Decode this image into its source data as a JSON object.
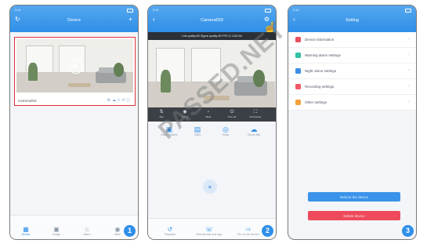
{
  "phone1": {
    "badge": "1",
    "header_title": "Device",
    "add_icon": "plus-icon",
    "camera_name": "Camera003",
    "card_icons": [
      "settings-icon",
      "cloud-icon",
      "share-icon",
      "playback-icon",
      "delete-icon"
    ],
    "tabs": [
      {
        "label": "Device",
        "icon": "device-icon",
        "active": true
      },
      {
        "label": "Image",
        "icon": "image-icon",
        "active": false
      },
      {
        "label": "Alarm",
        "icon": "bell-icon",
        "active": false
      },
      {
        "label": "Mine",
        "icon": "person-icon",
        "active": false
      }
    ]
  },
  "phone2": {
    "badge": "2",
    "header_title": "Camera003",
    "info_bar": "Link quality:60  Signal quality:56  FPS:11  CAN  Kb",
    "controls": [
      {
        "label": "Flip",
        "icon": "flip-icon"
      },
      {
        "label": "Sound",
        "icon": "sound-icon"
      },
      {
        "label": "Mute",
        "icon": "mute-icon"
      },
      {
        "label": "Turn off",
        "icon": "power-icon"
      },
      {
        "label": "Full screen",
        "icon": "fullscreen-icon"
      }
    ],
    "actions": [
      {
        "label": "Video Lantern",
        "icon": "video-icon"
      },
      {
        "label": "Video",
        "icon": "record-icon"
      },
      {
        "label": "Snap",
        "icon": "camera-icon"
      },
      {
        "label": "Cloud disk",
        "icon": "cloud-icon"
      }
    ],
    "bottom_actions": [
      {
        "label": "Playback",
        "icon": "playback-icon"
      },
      {
        "label": "Remote talk and sign",
        "icon": "talk-icon"
      },
      {
        "label": "Pin on the Screen",
        "icon": "pin-icon"
      }
    ]
  },
  "phone3": {
    "badge": "3",
    "header_title": "Setting",
    "menu": [
      {
        "label": "Device information",
        "color": "#e8505f"
      },
      {
        "label": "Warning alarm settings",
        "color": "#33c1a8"
      },
      {
        "label": "Night vision settings",
        "color": "#3f8fe6"
      },
      {
        "label": "Recording settings",
        "color": "#ee5a66"
      },
      {
        "label": "Other settings",
        "color": "#f3a23c"
      }
    ],
    "reboot_label": "Reboot the device",
    "delete_label": "Delete device"
  },
  "watermark": "PASSED.NET",
  "colors": {
    "header": "#2f8fe8",
    "selection": "#e0323a",
    "danger": "#ee4a5c"
  }
}
